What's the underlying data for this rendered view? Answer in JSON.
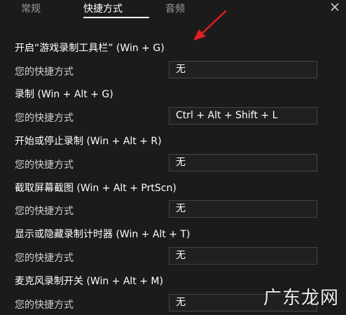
{
  "tabs": [
    {
      "label": "常规"
    },
    {
      "label": "快捷方式"
    },
    {
      "label": "音频"
    }
  ],
  "active_tab": "快捷方式",
  "close_icon": "close-icon",
  "shortcuts": [
    {
      "title": "开启“游戏录制工具栏” (Win + G)",
      "label": "您的快捷方式",
      "value": "无"
    },
    {
      "title": "录制 (Win + Alt + G)",
      "label": "您的快捷方式",
      "value": "Ctrl + Alt + Shift + L"
    },
    {
      "title": "开始或停止录制 (Win + Alt + R)",
      "label": "您的快捷方式",
      "value": "无"
    },
    {
      "title": "截取屏幕截图 (Win + Alt + PrtScn)",
      "label": "您的快捷方式",
      "value": "无"
    },
    {
      "title": "显示或隐藏录制计时器 (Win + Alt + T)",
      "label": "您的快捷方式",
      "value": "无"
    },
    {
      "title": "麦克风录制开关 (Win + Alt + M)",
      "label": "您的快捷方式",
      "value": "无"
    }
  ],
  "annotation_arrow": {
    "color": "#e02020"
  },
  "watermark": {
    "text": "广东龙网"
  }
}
